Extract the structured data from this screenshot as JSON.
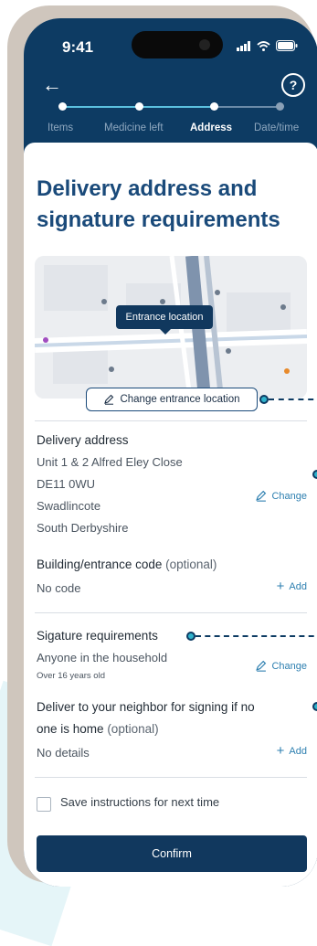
{
  "status_bar": {
    "time": "9:41"
  },
  "stepper": {
    "steps": [
      "Items",
      "Medicine left",
      "Address",
      "Date/time"
    ],
    "active_index": 2
  },
  "title": "Delivery address and signature requirements",
  "map": {
    "tooltip": "Entrance location",
    "change_button": "Change entrance location"
  },
  "delivery": {
    "label": "Delivery address",
    "lines": [
      "Unit 1 & 2 Alfred Eley Close",
      "DE11 0WU",
      "Swadlincote",
      "South Derbyshire"
    ],
    "action": "Change"
  },
  "code": {
    "label": "Building/entrance code",
    "optional": "(optional)",
    "value": "No code",
    "action": "Add"
  },
  "signature": {
    "label": "Sigature requirements",
    "value": "Anyone in the household",
    "note": "Over 16 years old",
    "action": "Change"
  },
  "neighbor": {
    "label_line1": "Deliver to your neighbor for signing if no",
    "label_line2": "one is home",
    "optional": "(optional)",
    "value": "No details",
    "action": "Add"
  },
  "save_instructions": "Save instructions for next time",
  "confirm": "Confirm",
  "colors": {
    "navy": "#0d3b63",
    "accent": "#30b3cc",
    "link": "#2d7fb0"
  }
}
